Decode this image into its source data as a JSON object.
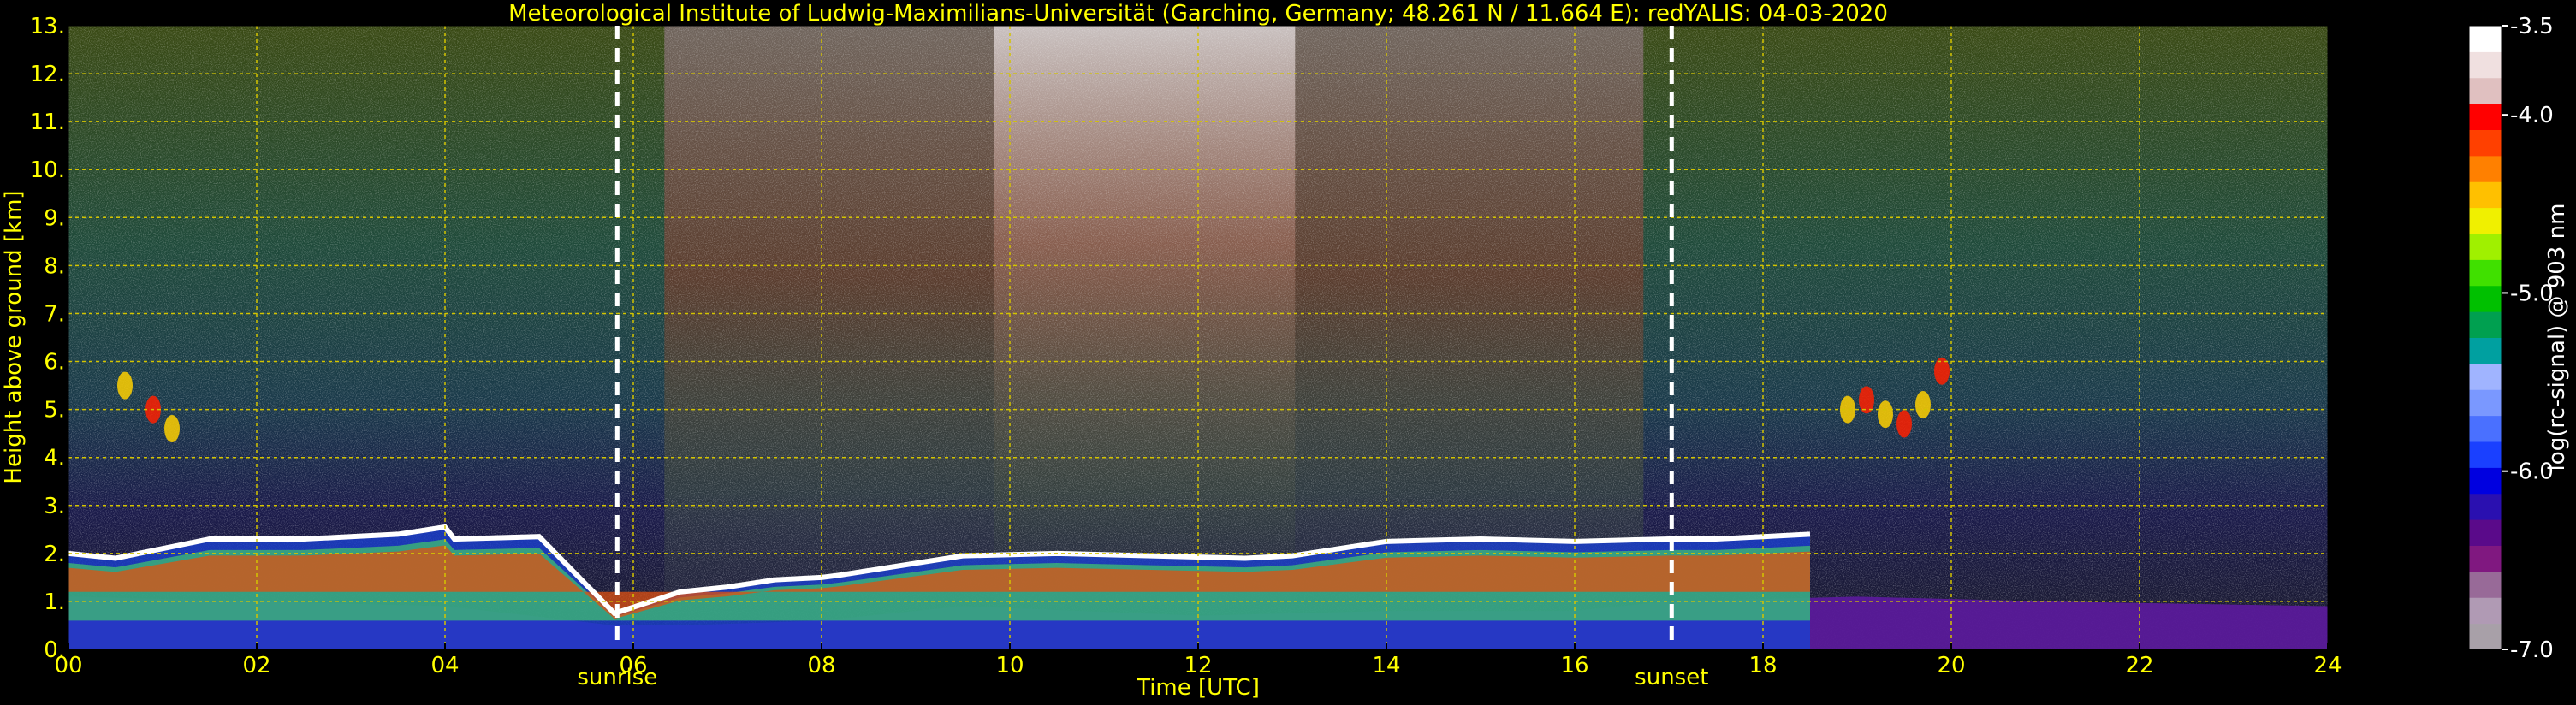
{
  "chart_data": {
    "type": "heatmap",
    "title": "Meteorological Institute of Ludwig-Maximilians-Universität (Garching, Germany; 48.261 N / 11.664 E):    redYALIS: 04-03-2020",
    "xlabel": "Time [UTC]",
    "ylabel": "Height above ground [km]",
    "xlim": [
      0,
      24
    ],
    "ylim": [
      0,
      13
    ],
    "x_ticks": [
      "00",
      "02",
      "04",
      "06",
      "08",
      "10",
      "12",
      "14",
      "16",
      "18",
      "20",
      "22",
      "24"
    ],
    "y_ticks": [
      "0.",
      "1.",
      "2.",
      "3.",
      "4.",
      "5.",
      "6.",
      "7.",
      "8.",
      "9.",
      "10.",
      "11.",
      "12.",
      "13."
    ],
    "grid": true,
    "annotations": [
      {
        "label": "sunrise",
        "x": 5.83
      },
      {
        "label": "sunset",
        "x": 17.03
      }
    ],
    "colorbar": {
      "label": "log(rc-signal) @ 903 nm",
      "range": [
        -7.0,
        -3.5
      ],
      "ticks": [
        "-3.5",
        "-4.0",
        "-5.0",
        "-6.0",
        "-7.0"
      ],
      "tick_values": [
        -3.5,
        -4.0,
        -5.0,
        -6.0,
        -7.0
      ]
    },
    "features": [
      {
        "name": "boundary layer top",
        "points": [
          [
            0.0,
            2.0
          ],
          [
            0.5,
            1.9
          ],
          [
            1.0,
            2.1
          ],
          [
            1.5,
            2.3
          ],
          [
            2.5,
            2.3
          ],
          [
            3.5,
            2.4
          ],
          [
            4.0,
            2.55
          ],
          [
            4.1,
            2.3
          ],
          [
            5.0,
            2.35
          ],
          [
            5.8,
            0.75
          ],
          [
            6.5,
            1.2
          ],
          [
            7.0,
            1.3
          ],
          [
            7.5,
            1.45
          ],
          [
            8.0,
            1.5
          ],
          [
            8.2,
            1.55
          ],
          [
            9.5,
            1.95
          ],
          [
            10.5,
            2.0
          ],
          [
            11.5,
            1.95
          ],
          [
            12.5,
            1.9
          ],
          [
            13.0,
            1.95
          ],
          [
            14.0,
            2.25
          ],
          [
            15.0,
            2.3
          ],
          [
            16.0,
            2.25
          ],
          [
            17.0,
            2.3
          ],
          [
            17.5,
            2.3
          ],
          [
            18.0,
            2.35
          ],
          [
            18.5,
            2.4
          ]
        ]
      },
      {
        "name": "aerosol layer",
        "points": [
          [
            0.0,
            1.1
          ],
          [
            4.0,
            0.9
          ],
          [
            5.8,
            0.5
          ],
          [
            6.5,
            0.5
          ],
          [
            8.0,
            0.6
          ],
          [
            9.5,
            0.9
          ],
          [
            12.0,
            0.7
          ],
          [
            14.0,
            0.8
          ],
          [
            16.0,
            0.8
          ],
          [
            17.0,
            1.0
          ],
          [
            19.0,
            1.1
          ],
          [
            21.0,
            1.0
          ],
          [
            24.0,
            0.9
          ]
        ]
      },
      {
        "name": "cloud",
        "points": [
          [
            18.9,
            5.0
          ],
          [
            19.1,
            5.2
          ],
          [
            19.3,
            4.9
          ],
          [
            19.5,
            4.7
          ],
          [
            19.7,
            5.1
          ],
          [
            19.9,
            5.8
          ]
        ]
      },
      {
        "name": "cloud",
        "points": [
          [
            0.6,
            5.5
          ],
          [
            0.9,
            5.0
          ],
          [
            1.1,
            4.6
          ]
        ]
      }
    ]
  },
  "colors": {
    "text": "#ffff00",
    "grid": "#d4c400",
    "marker_lines": "#ffffff",
    "background": "#000000",
    "colormap": [
      "#a8a0a8",
      "#b09ab4",
      "#986a98",
      "#801880",
      "#5a0a8a",
      "#2a10b0",
      "#0000e0",
      "#1a40ff",
      "#4a70ff",
      "#7a98ff",
      "#a0b4ff",
      "#00a0a0",
      "#00a050",
      "#00c000",
      "#40e000",
      "#a0f000",
      "#f0f000",
      "#ffc000",
      "#ff8000",
      "#ff4000",
      "#ff0000",
      "#e0c0c0",
      "#f0e0e0",
      "#ffffff"
    ]
  }
}
